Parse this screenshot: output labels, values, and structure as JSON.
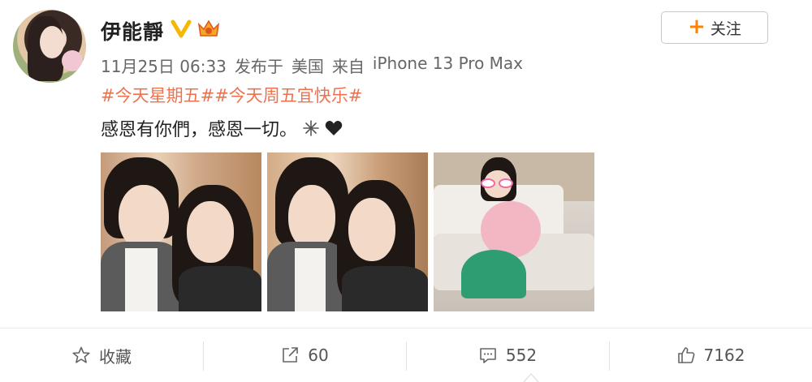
{
  "user": {
    "name": "伊能靜"
  },
  "follow": {
    "plus": "+",
    "label": "关注"
  },
  "meta": {
    "date": "11月25日 06:33",
    "posted": "发布于",
    "location": "美国",
    "from": "来自",
    "device": "iPhone 13 Pro Max"
  },
  "post": {
    "topics": "#今天星期五##今天周五宜快乐#",
    "text": "感恩有你們，感恩一切。"
  },
  "actions": {
    "favorite_label": "收藏",
    "repost_count": "60",
    "comment_count": "552",
    "like_count": "7162"
  },
  "colors": {
    "accent_orange": "#ff8200",
    "topic": "#eb7350",
    "verify_gold": "#f5b800"
  },
  "icons": [
    "verified-icon",
    "crown-badge-icon",
    "sparkle-icon",
    "heart-icon",
    "star-icon",
    "repost-icon",
    "comment-icon",
    "thumbs-up-icon"
  ]
}
